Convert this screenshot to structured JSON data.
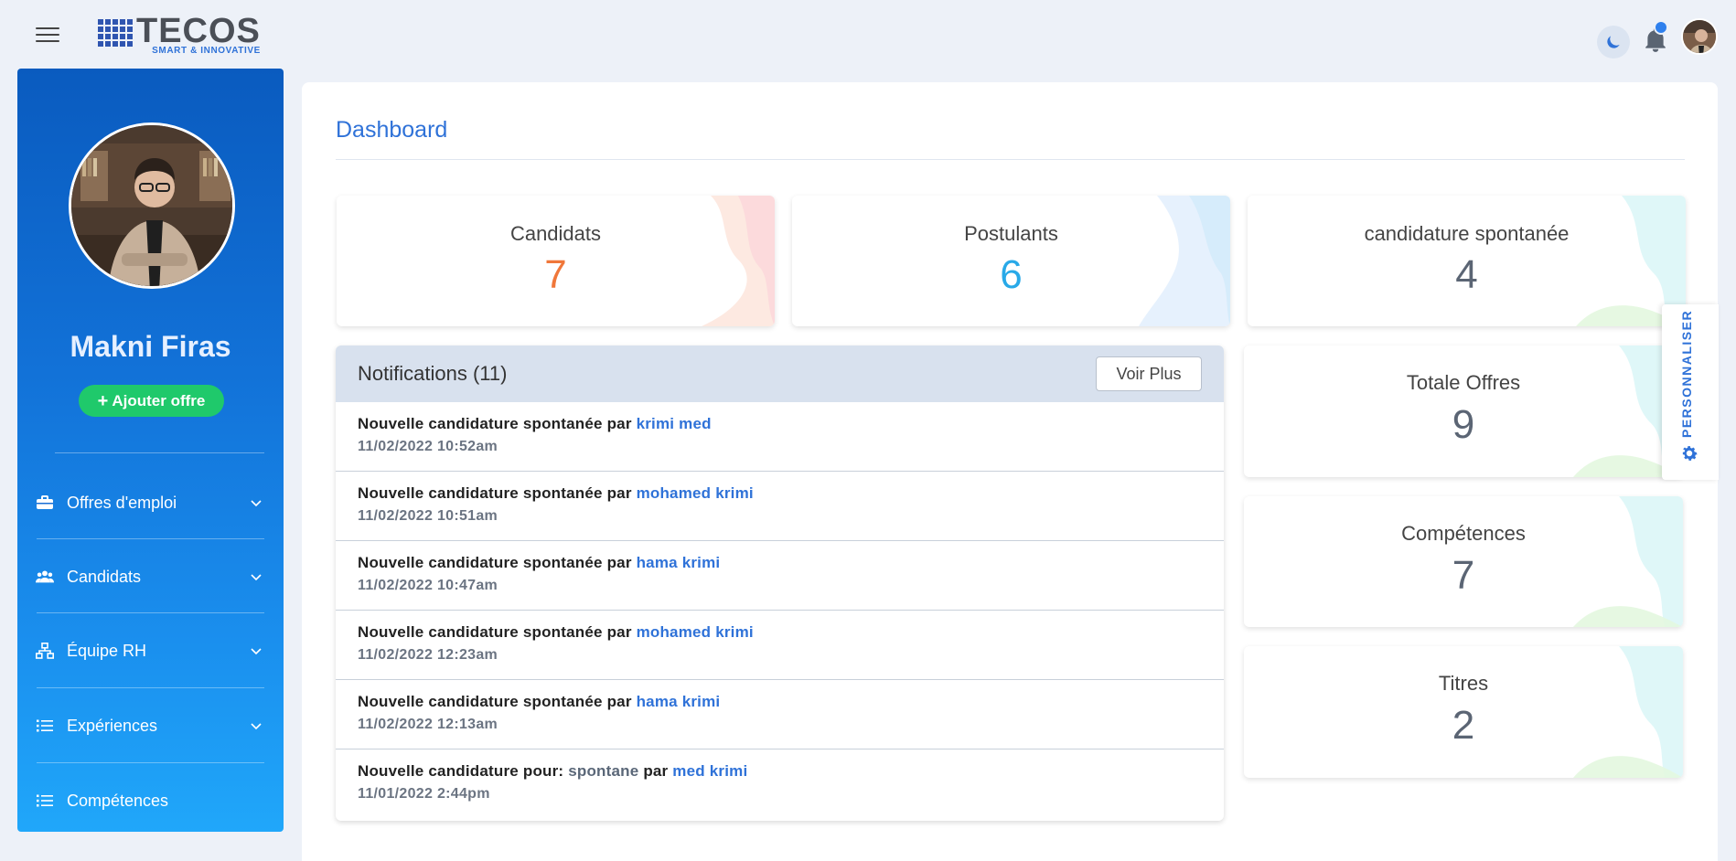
{
  "app": {
    "logo_main": "TECOS",
    "logo_sub": "SMART & INNOVATIVE"
  },
  "sidebar": {
    "user_name": "Makni Firas",
    "add_offer_label": "Ajouter offre",
    "items": [
      {
        "label": "Offres d'emploi",
        "icon": "briefcase-icon"
      },
      {
        "label": "Candidats",
        "icon": "users-icon"
      },
      {
        "label": "Équipe RH",
        "icon": "org-chart-icon"
      },
      {
        "label": "Expériences",
        "icon": "list-icon"
      },
      {
        "label": "Compétences",
        "icon": "list-icon"
      }
    ]
  },
  "main": {
    "title": "Dashboard",
    "stats": [
      {
        "label": "Candidats",
        "value": "7",
        "color": "#f0773a"
      },
      {
        "label": "Postulants",
        "value": "6",
        "color": "#28a9e8"
      },
      {
        "label": "candidature spontanée",
        "value": "4",
        "color": "#5b6574"
      },
      {
        "label": "Totale Offres",
        "value": "9",
        "color": "#5b6574"
      },
      {
        "label": "Compétences",
        "value": "7",
        "color": "#5b6574"
      },
      {
        "label": "Titres",
        "value": "2",
        "color": "#5b6574"
      }
    ],
    "notifications": {
      "title": "Notifications (11)",
      "more_label": "Voir Plus",
      "items": [
        {
          "prefix": "Nouvelle candidature spontanée par ",
          "name": "krimi med",
          "date": "11/02/2022 10:52am"
        },
        {
          "prefix": "Nouvelle candidature spontanée par ",
          "name": "mohamed krimi",
          "date": "11/02/2022 10:51am"
        },
        {
          "prefix": "Nouvelle candidature spontanée par ",
          "name": "hama krimi",
          "date": "11/02/2022 10:47am"
        },
        {
          "prefix": "Nouvelle candidature spontanée par ",
          "name": "mohamed krimi",
          "date": "11/02/2022 12:23am"
        },
        {
          "prefix": "Nouvelle candidature spontanée par ",
          "name": "hama krimi",
          "date": "11/02/2022 12:13am"
        },
        {
          "prefix": "Nouvelle candidature pour: ",
          "position": "spontane",
          "middle": " par ",
          "name": "med krimi",
          "date": "11/01/2022 2:44pm"
        }
      ]
    }
  },
  "customizer": {
    "label": "PERSONNALISER"
  },
  "colors": {
    "accent": "#2f72d8",
    "sidebar_top": "#0a5bbf",
    "sidebar_bottom": "#20a7fa",
    "add_button": "#1fc96b"
  }
}
